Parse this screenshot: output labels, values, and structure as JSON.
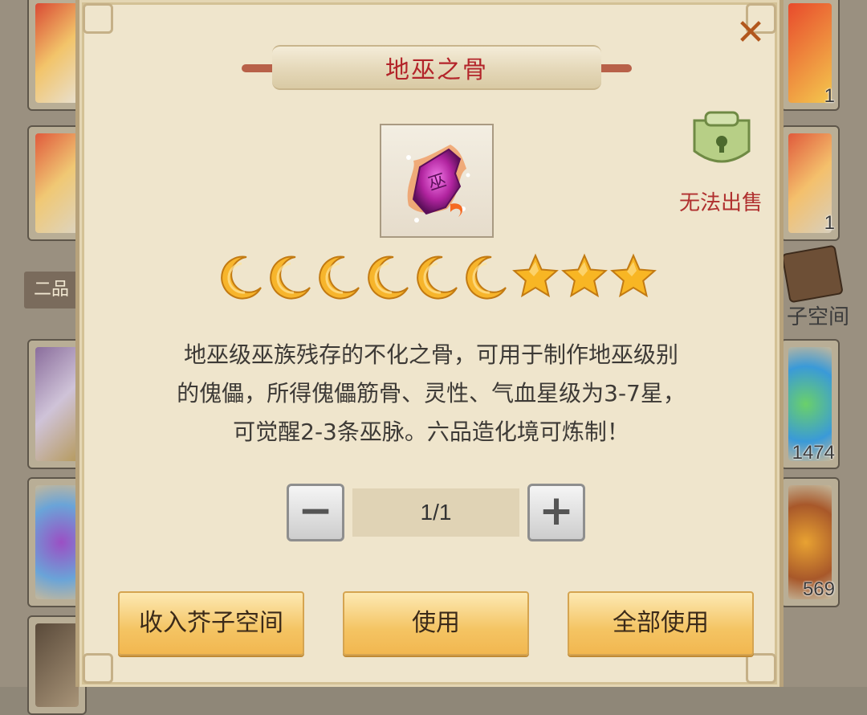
{
  "dialog": {
    "title": "地巫之骨",
    "item_icon": "purple-bone-rune-icon",
    "sell_status": "无法出售",
    "rating": {
      "moons": 6,
      "stars": 3
    },
    "description_lines": [
      "地巫级巫族残存的不化之骨，可用于制作地巫级别",
      "的傀儡，所得傀儡筋骨、灵性、气血星级为3-7星，",
      "可觉醒2-3条巫脉。六品造化境可炼制！"
    ],
    "quantity": {
      "value": "1/1",
      "minus_label": "−",
      "plus_label": "+"
    },
    "buttons": {
      "store": "收入芥子空间",
      "use": "使用",
      "use_all": "全部使用"
    },
    "close_icon": "close-icon"
  },
  "background": {
    "tab_label": "二品",
    "space_label": "子空间",
    "counts": [
      "1",
      "1",
      "1474",
      "569"
    ]
  },
  "colors": {
    "title": "#b3242a",
    "sell_status": "#b0302f",
    "close": "#b2571d",
    "button_gold": "#f4c463"
  }
}
